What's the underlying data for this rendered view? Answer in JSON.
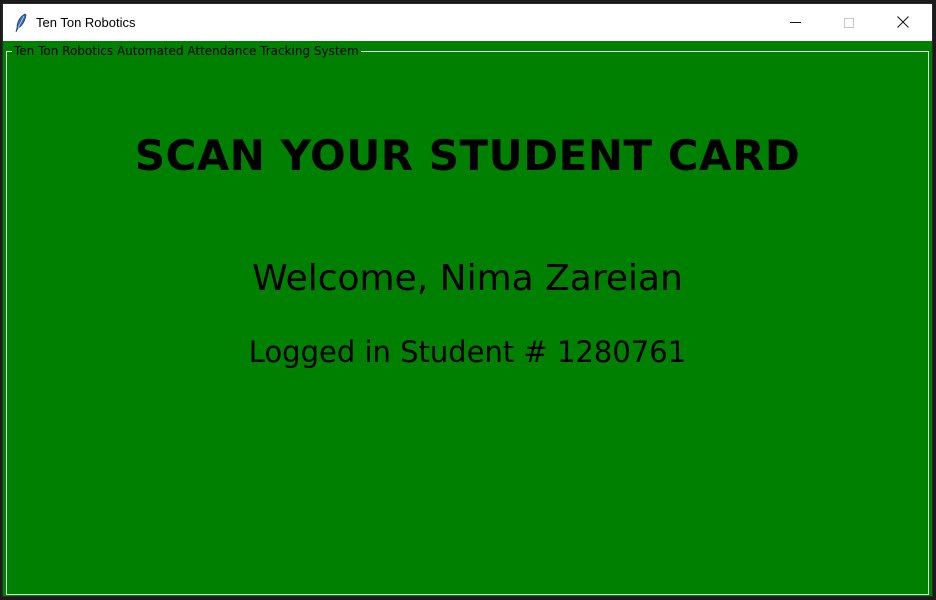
{
  "window": {
    "title": "Ten Ton Robotics",
    "icon": "feather-icon"
  },
  "frame": {
    "label": "Ten Ton Robotics Automated Attendance Tracking System"
  },
  "main": {
    "headline": "SCAN YOUR STUDENT CARD",
    "welcome": "Welcome, Nima Zareian",
    "student_line": "Logged in Student # 1280761"
  },
  "colors": {
    "background": "#008000",
    "text": "#000000"
  }
}
